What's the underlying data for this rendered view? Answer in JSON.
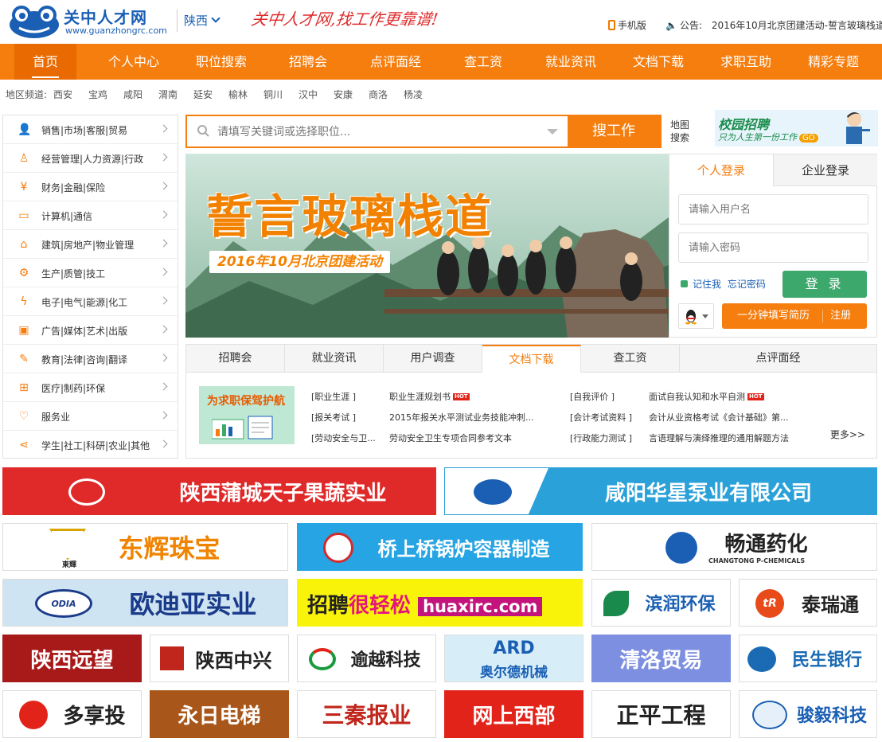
{
  "site": {
    "name": "关中人才网",
    "url": "www.guanzhongrc.com",
    "region": "陕西",
    "slogan": "关中人才网,找工作更靠谱!",
    "mobile": "手机版",
    "notice_label": "公告:",
    "notice_text": "2016年10月北京团建活动-誓言玻璃栈道"
  },
  "nav": [
    "首页",
    "个人中心",
    "职位搜索",
    "招聘会",
    "点评面经",
    "查工资",
    "就业资讯",
    "文档下载",
    "求职互助",
    "精彩专题"
  ],
  "area": {
    "label": "地区频道:",
    "cities": [
      "西安",
      "宝鸡",
      "咸阳",
      "渭南",
      "延安",
      "榆林",
      "铜川",
      "汉中",
      "安康",
      "商洛",
      "杨凌"
    ]
  },
  "categories": [
    {
      "label": "销售|市场|客服|贸易",
      "icon": "person-icon"
    },
    {
      "label": "经营管理|人力资源|行政",
      "icon": "medal-icon"
    },
    {
      "label": "财务|金融|保险",
      "icon": "yen-icon"
    },
    {
      "label": "计算机|通信",
      "icon": "monitor-icon"
    },
    {
      "label": "建筑|房地产|物业管理",
      "icon": "house-icon"
    },
    {
      "label": "生产|质管|技工",
      "icon": "gear-icon"
    },
    {
      "label": "电子|电气|能源|化工",
      "icon": "lightning-icon"
    },
    {
      "label": "广告|媒体|艺术|出版",
      "icon": "camera-icon"
    },
    {
      "label": "教育|法律|咨询|翻译",
      "icon": "pencil-icon"
    },
    {
      "label": "医疗|制药|环保",
      "icon": "medical-cross-icon"
    },
    {
      "label": "服务业",
      "icon": "heart-icon"
    },
    {
      "label": "学生|社工|科研|农业|其他",
      "icon": "share-icon"
    }
  ],
  "search": {
    "placeholder": "请填写关键词或选择职位...",
    "button": "搜工作",
    "map_search": "地图搜索"
  },
  "campus": {
    "title": "校园招聘",
    "subtitle": "只为人生第一份工作",
    "go": "GO"
  },
  "banner": {
    "title": "誓言玻璃栈道",
    "subtitle": "2016年10月北京团建活动"
  },
  "login": {
    "tab_personal": "个人登录",
    "tab_company": "企业登录",
    "username_placeholder": "请输入用户名",
    "password_placeholder": "请输入密码",
    "remember": "记住我",
    "forgot": "忘记密码",
    "login_button": "登 录",
    "resume_button": "一分钟填写简历",
    "register_button": "注册"
  },
  "tabs": [
    "招聘会",
    "就业资讯",
    "用户调查",
    "文档下载",
    "查工资",
    "点评面经"
  ],
  "active_tab": 3,
  "docs": {
    "image_title": "为求职保驾护航",
    "left": [
      {
        "cat": "[职业生涯 ]",
        "title": "职业生涯规划书",
        "hot": true
      },
      {
        "cat": "[报关考试 ]",
        "title": "2015年报关水平测试业务技能冲刺...",
        "hot": false
      },
      {
        "cat": "[劳动安全与卫...",
        "title": "劳动安全卫生专项合同参考文本",
        "hot": false
      }
    ],
    "right": [
      {
        "cat": "[自我评价 ]",
        "title": "面试自我认知和水平自测",
        "hot": true
      },
      {
        "cat": "[会计考试资料 ]",
        "title": "会计从业资格考试《会计基础》第...",
        "hot": false
      },
      {
        "cat": "[行政能力测试 ]",
        "title": "言语理解与演绎推理的通用解题方法",
        "hot": false
      }
    ],
    "hot_label": "HOT",
    "more": "更多>>"
  },
  "companies": {
    "row1": [
      "陕西蒲城天子果蔬实业",
      "咸阳华星泵业有限公司"
    ],
    "row2": [
      "东辉珠宝",
      "桥上桥锅炉容器制造",
      "畅通药化"
    ],
    "row2_sub": [
      "東輝",
      "",
      "CHANGTONG P-CHEMICALS"
    ],
    "row3": [
      "欧迪亚实业",
      "招聘",
      "很轻松",
      "huaxirc.com",
      "滨润环保",
      "泰瑞通"
    ],
    "row3_badge": [
      "ODIA",
      "",
      "",
      "",
      "",
      "tR"
    ],
    "row4": [
      "陕西远望",
      "陕西中兴",
      "逾越科技",
      "ARD",
      "奥尔德机械",
      "清洛贸易",
      "民生银行"
    ],
    "row5": [
      "多享投",
      "永日电梯",
      "三秦报业",
      "网上西部",
      "正平工程",
      "骏毅科技"
    ]
  },
  "colors": {
    "brand_orange": "#f57e0e",
    "brand_blue": "#1a5fb4",
    "login_green": "#3ca86c",
    "hot_red": "#e2231a"
  }
}
